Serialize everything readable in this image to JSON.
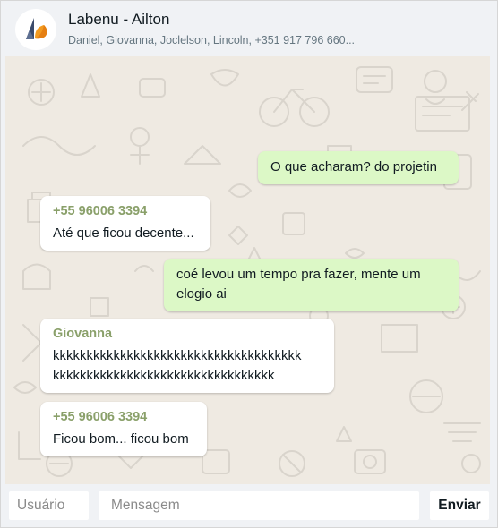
{
  "header": {
    "title": "Labenu - Ailton",
    "subtitle": "Daniel, Giovanna, Joclelson, Lincoln, +351 917 796 660...",
    "avatar_icon": "labenu-logo-icon"
  },
  "messages": [
    {
      "type": "sent",
      "sender": "",
      "text": "O que acharam? do projetin"
    },
    {
      "type": "received",
      "sender": "+55 96006 3394",
      "text": "Até que ficou decente..."
    },
    {
      "type": "sent",
      "sender": "",
      "text": "coé levou um tempo pra fazer, mente um\nelogio ai"
    },
    {
      "type": "received",
      "sender": "Giovanna",
      "text": "kkkkkkkkkkkkkkkkkkkkkkkkkkkkkkkkkkkkk\nkkkkkkkkkkkkkkkkkkkkkkkkkkkkkkkkk"
    },
    {
      "type": "received",
      "sender": "+55 96006 3394",
      "text": "Ficou bom... ficou bom"
    }
  ],
  "footer": {
    "user_placeholder": "Usuário",
    "message_placeholder": "Mensagem",
    "send_label": "Enviar"
  },
  "colors": {
    "sent_bubble": "#dcf8c6",
    "received_bubble": "#ffffff",
    "sender_name": "#8aa06a",
    "chat_background": "#efeae2",
    "header_background": "#f0f2f5"
  }
}
